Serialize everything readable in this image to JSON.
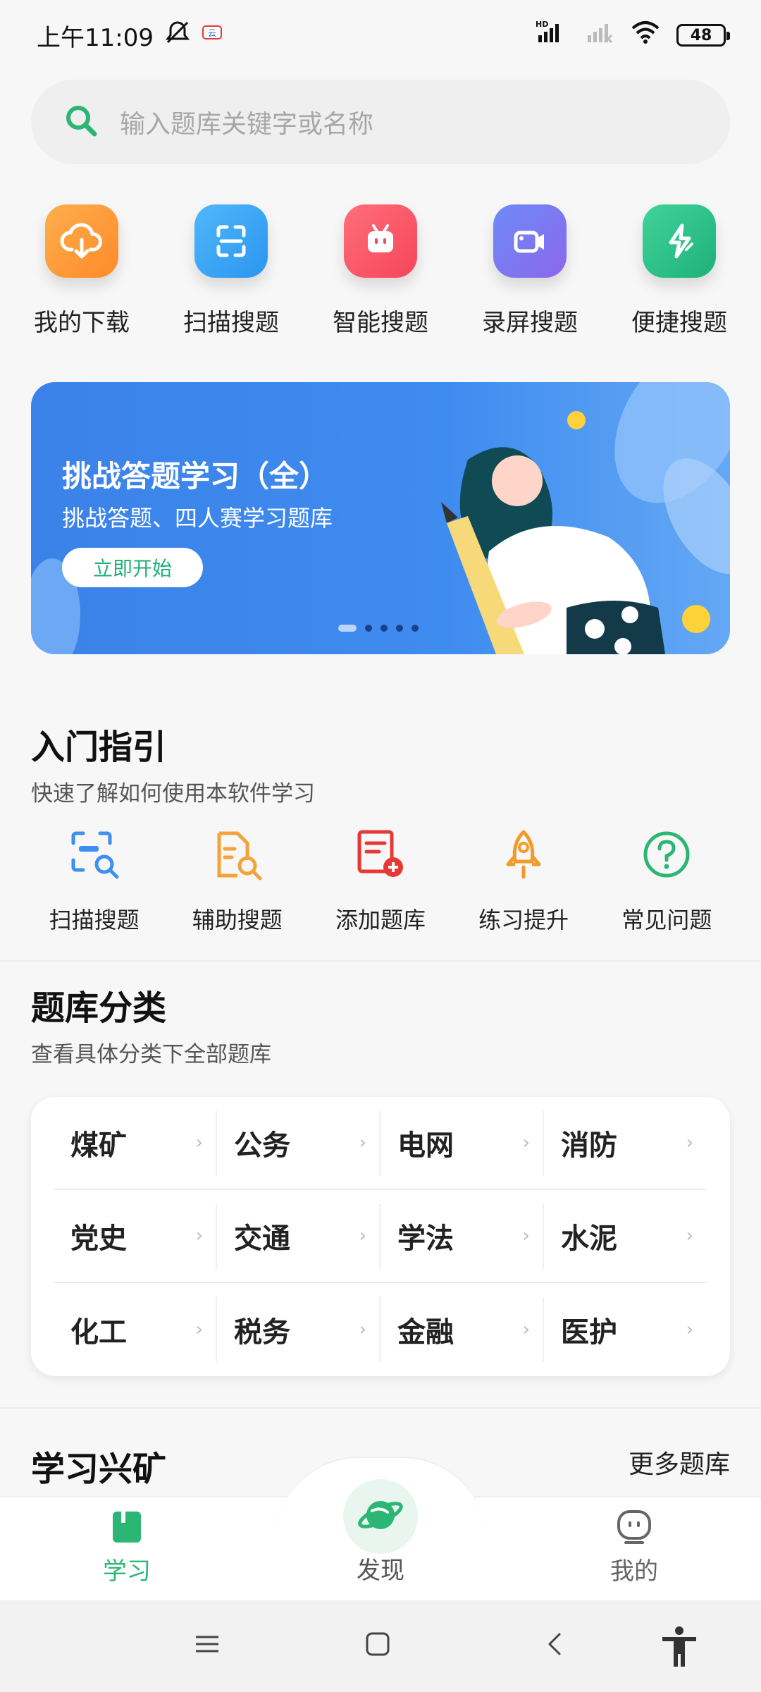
{
  "status_bar": {
    "time": "上午11:09",
    "network_hd": "HD",
    "battery": "48"
  },
  "search": {
    "placeholder": "输入题库关键字或名称"
  },
  "quick_actions": [
    {
      "label": "我的下载",
      "icon": "cloud-download-icon",
      "color": "#ff9a3c"
    },
    {
      "label": "扫描搜题",
      "icon": "scan-icon",
      "color": "#3aa5f5"
    },
    {
      "label": "智能搜题",
      "icon": "robot-icon",
      "color": "#ff5a6a"
    },
    {
      "label": "录屏搜题",
      "icon": "video-icon",
      "color": "#7a78f0"
    },
    {
      "label": "便捷搜题",
      "icon": "lightning-icon",
      "color": "#2bc58a"
    }
  ],
  "banner": {
    "title": "挑战答题学习（全）",
    "subtitle": "挑战答题、四人赛学习题库",
    "button": "立即开始"
  },
  "guide": {
    "title": "入门指引",
    "subtitle": "快速了解如何使用本软件学习",
    "items": [
      {
        "label": "扫描搜题",
        "icon": "scan-search-icon"
      },
      {
        "label": "辅助搜题",
        "icon": "document-search-icon"
      },
      {
        "label": "添加题库",
        "icon": "add-document-icon"
      },
      {
        "label": "练习提升",
        "icon": "rocket-icon"
      },
      {
        "label": "常见问题",
        "icon": "question-icon"
      }
    ]
  },
  "categories": {
    "title": "题库分类",
    "subtitle": "查看具体分类下全部题库",
    "rows": [
      [
        "煤矿",
        "公务",
        "电网",
        "消防"
      ],
      [
        "党史",
        "交通",
        "学法",
        "水泥"
      ],
      [
        "化工",
        "税务",
        "金融",
        "医护"
      ]
    ]
  },
  "study": {
    "title": "学习兴矿",
    "more": "更多题库"
  },
  "bottom_nav": {
    "study": "学习",
    "discover": "发现",
    "mine": "我的"
  },
  "colors": {
    "accent": "#2bb673"
  }
}
